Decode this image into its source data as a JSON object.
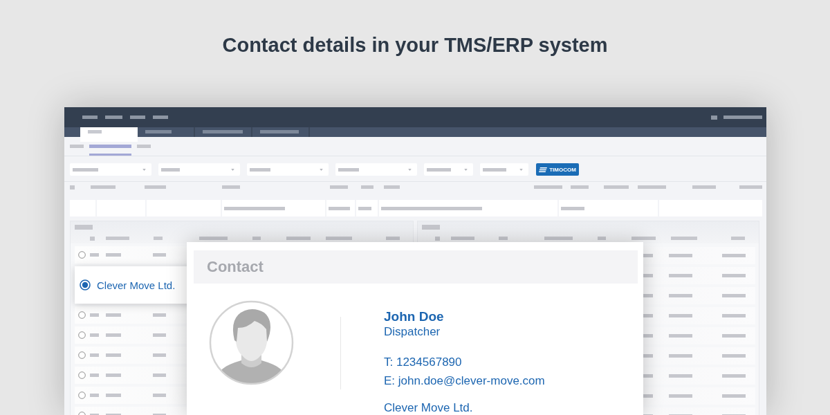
{
  "heading": "Contact details in your TMS/ERP system",
  "app": {
    "tabs": [
      {
        "selected": true
      },
      {
        "selected": false
      },
      {
        "selected": false
      },
      {
        "selected": false
      }
    ],
    "subnav": [
      {
        "selected": false
      },
      {
        "selected": true
      },
      {
        "selected": false
      }
    ],
    "filter_button": {
      "label": "TIMOCOM"
    },
    "carriers": [
      {
        "selected": false
      },
      {
        "selected": true,
        "label": "Clever Move Ltd."
      },
      {
        "selected": false
      },
      {
        "selected": false
      },
      {
        "selected": false
      },
      {
        "selected": false
      },
      {
        "selected": false
      },
      {
        "selected": false
      }
    ]
  },
  "contact_card": {
    "title": "Contact",
    "name": "John Doe",
    "role": "Dispatcher",
    "phone": "T: 1234567890",
    "email": "E: john.doe@clever-move.com",
    "company": "Clever Move Ltd."
  }
}
